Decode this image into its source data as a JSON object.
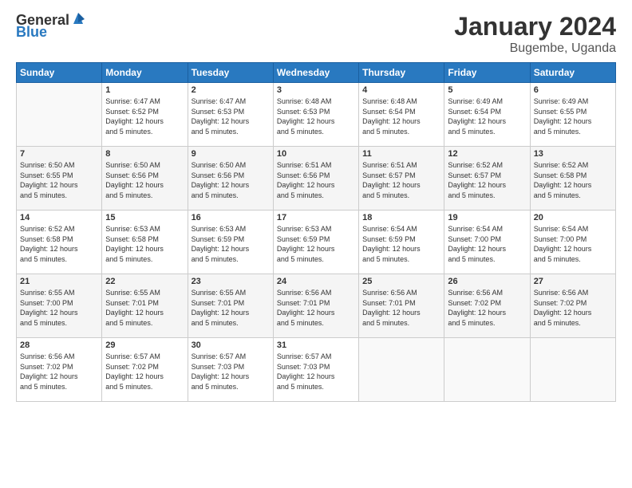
{
  "logo": {
    "general": "General",
    "blue": "Blue"
  },
  "title": "January 2024",
  "location": "Bugembe, Uganda",
  "days_of_week": [
    "Sunday",
    "Monday",
    "Tuesday",
    "Wednesday",
    "Thursday",
    "Friday",
    "Saturday"
  ],
  "weeks": [
    [
      {
        "day": "",
        "info": ""
      },
      {
        "day": "1",
        "info": "Sunrise: 6:47 AM\nSunset: 6:52 PM\nDaylight: 12 hours\nand 5 minutes."
      },
      {
        "day": "2",
        "info": "Sunrise: 6:47 AM\nSunset: 6:53 PM\nDaylight: 12 hours\nand 5 minutes."
      },
      {
        "day": "3",
        "info": "Sunrise: 6:48 AM\nSunset: 6:53 PM\nDaylight: 12 hours\nand 5 minutes."
      },
      {
        "day": "4",
        "info": "Sunrise: 6:48 AM\nSunset: 6:54 PM\nDaylight: 12 hours\nand 5 minutes."
      },
      {
        "day": "5",
        "info": "Sunrise: 6:49 AM\nSunset: 6:54 PM\nDaylight: 12 hours\nand 5 minutes."
      },
      {
        "day": "6",
        "info": "Sunrise: 6:49 AM\nSunset: 6:55 PM\nDaylight: 12 hours\nand 5 minutes."
      }
    ],
    [
      {
        "day": "7",
        "info": "Sunrise: 6:50 AM\nSunset: 6:55 PM\nDaylight: 12 hours\nand 5 minutes."
      },
      {
        "day": "8",
        "info": "Sunrise: 6:50 AM\nSunset: 6:56 PM\nDaylight: 12 hours\nand 5 minutes."
      },
      {
        "day": "9",
        "info": "Sunrise: 6:50 AM\nSunset: 6:56 PM\nDaylight: 12 hours\nand 5 minutes."
      },
      {
        "day": "10",
        "info": "Sunrise: 6:51 AM\nSunset: 6:56 PM\nDaylight: 12 hours\nand 5 minutes."
      },
      {
        "day": "11",
        "info": "Sunrise: 6:51 AM\nSunset: 6:57 PM\nDaylight: 12 hours\nand 5 minutes."
      },
      {
        "day": "12",
        "info": "Sunrise: 6:52 AM\nSunset: 6:57 PM\nDaylight: 12 hours\nand 5 minutes."
      },
      {
        "day": "13",
        "info": "Sunrise: 6:52 AM\nSunset: 6:58 PM\nDaylight: 12 hours\nand 5 minutes."
      }
    ],
    [
      {
        "day": "14",
        "info": "Sunrise: 6:52 AM\nSunset: 6:58 PM\nDaylight: 12 hours\nand 5 minutes."
      },
      {
        "day": "15",
        "info": "Sunrise: 6:53 AM\nSunset: 6:58 PM\nDaylight: 12 hours\nand 5 minutes."
      },
      {
        "day": "16",
        "info": "Sunrise: 6:53 AM\nSunset: 6:59 PM\nDaylight: 12 hours\nand 5 minutes."
      },
      {
        "day": "17",
        "info": "Sunrise: 6:53 AM\nSunset: 6:59 PM\nDaylight: 12 hours\nand 5 minutes."
      },
      {
        "day": "18",
        "info": "Sunrise: 6:54 AM\nSunset: 6:59 PM\nDaylight: 12 hours\nand 5 minutes."
      },
      {
        "day": "19",
        "info": "Sunrise: 6:54 AM\nSunset: 7:00 PM\nDaylight: 12 hours\nand 5 minutes."
      },
      {
        "day": "20",
        "info": "Sunrise: 6:54 AM\nSunset: 7:00 PM\nDaylight: 12 hours\nand 5 minutes."
      }
    ],
    [
      {
        "day": "21",
        "info": "Sunrise: 6:55 AM\nSunset: 7:00 PM\nDaylight: 12 hours\nand 5 minutes."
      },
      {
        "day": "22",
        "info": "Sunrise: 6:55 AM\nSunset: 7:01 PM\nDaylight: 12 hours\nand 5 minutes."
      },
      {
        "day": "23",
        "info": "Sunrise: 6:55 AM\nSunset: 7:01 PM\nDaylight: 12 hours\nand 5 minutes."
      },
      {
        "day": "24",
        "info": "Sunrise: 6:56 AM\nSunset: 7:01 PM\nDaylight: 12 hours\nand 5 minutes."
      },
      {
        "day": "25",
        "info": "Sunrise: 6:56 AM\nSunset: 7:01 PM\nDaylight: 12 hours\nand 5 minutes."
      },
      {
        "day": "26",
        "info": "Sunrise: 6:56 AM\nSunset: 7:02 PM\nDaylight: 12 hours\nand 5 minutes."
      },
      {
        "day": "27",
        "info": "Sunrise: 6:56 AM\nSunset: 7:02 PM\nDaylight: 12 hours\nand 5 minutes."
      }
    ],
    [
      {
        "day": "28",
        "info": "Sunrise: 6:56 AM\nSunset: 7:02 PM\nDaylight: 12 hours\nand 5 minutes."
      },
      {
        "day": "29",
        "info": "Sunrise: 6:57 AM\nSunset: 7:02 PM\nDaylight: 12 hours\nand 5 minutes."
      },
      {
        "day": "30",
        "info": "Sunrise: 6:57 AM\nSunset: 7:03 PM\nDaylight: 12 hours\nand 5 minutes."
      },
      {
        "day": "31",
        "info": "Sunrise: 6:57 AM\nSunset: 7:03 PM\nDaylight: 12 hours\nand 5 minutes."
      },
      {
        "day": "",
        "info": ""
      },
      {
        "day": "",
        "info": ""
      },
      {
        "day": "",
        "info": ""
      }
    ]
  ]
}
